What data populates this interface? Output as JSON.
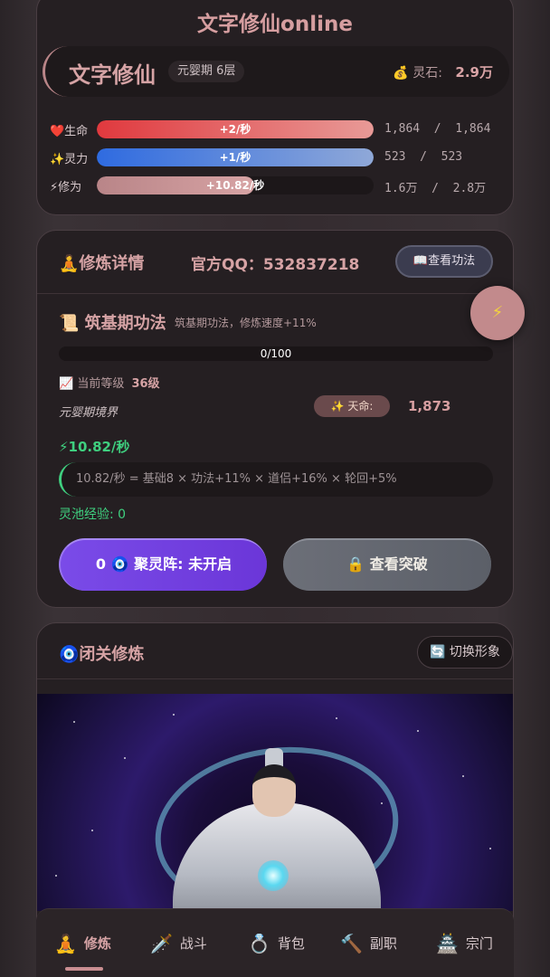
{
  "app": {
    "title": "文字修仙online"
  },
  "player": {
    "name": "文字修仙",
    "realm": "元婴期 6层",
    "stone_icon": "money-bag-icon",
    "stone_label": "灵石:",
    "stone_value": "2.9万"
  },
  "stats": [
    {
      "icon": "heart-icon",
      "label": "❤️生命",
      "rate": "+2/秒",
      "current": "1,864",
      "max": "1,864",
      "fill": 1.0,
      "color": "#e0393e"
    },
    {
      "icon": "sparkle-icon",
      "label": "✨灵力",
      "rate": "+1/秒",
      "current": "523",
      "max": "523",
      "fill": 1.0,
      "color": "#2f6be0"
    },
    {
      "icon": "lightning-icon",
      "label": "⚡修为",
      "rate": "+10.82/秒",
      "current": "1.6万",
      "max": "2.8万",
      "fill": 0.57,
      "color": "#c98e91"
    }
  ],
  "cultivation": {
    "title": "🧘修炼详情",
    "qq": "官方QQ：532837218",
    "view_gongfa": "📖查看功法",
    "gongfa_name": "📜 筑基期功法",
    "gongfa_desc": "筑基期功法，修炼速度+11%",
    "exp_text": "0/100",
    "exp_fill": 0.0,
    "level_label": "📈 当前等级",
    "level_value": "36级",
    "realm_text": "元婴期境界",
    "tianming_label": "✨ 天命:",
    "tianming_value": "1,873",
    "rate": "⚡10.82/秒",
    "formula": "10.82/秒 = 基础8 × 功法+11% × 道侣+16% × 轮回+5%",
    "pool_exp": "灵池经验: 0",
    "juling_button": "0 🧿 聚灵阵: 未开启",
    "breakthrough_button": "🔒 查看突破"
  },
  "fab": {
    "icon": "lightning-icon",
    "glyph": "⚡"
  },
  "retreat": {
    "title": "🧿闭关修炼",
    "switch_button": "🔄 切换形象"
  },
  "nav": [
    {
      "icon": "meditation-icon",
      "glyph": "🧘",
      "label": "修炼",
      "active": true
    },
    {
      "icon": "dagger-icon",
      "glyph": "🗡️",
      "label": "战斗",
      "active": false
    },
    {
      "icon": "ring-icon",
      "glyph": "💍",
      "label": "背包",
      "active": false
    },
    {
      "icon": "hammer-icon",
      "glyph": "🔨",
      "label": "副职",
      "active": false
    },
    {
      "icon": "temple-icon",
      "glyph": "🏯",
      "label": "宗门",
      "active": false
    }
  ],
  "colors": {
    "accent": "#d6a3a5",
    "green": "#3fcf7f",
    "purple": "#7a4be8"
  }
}
